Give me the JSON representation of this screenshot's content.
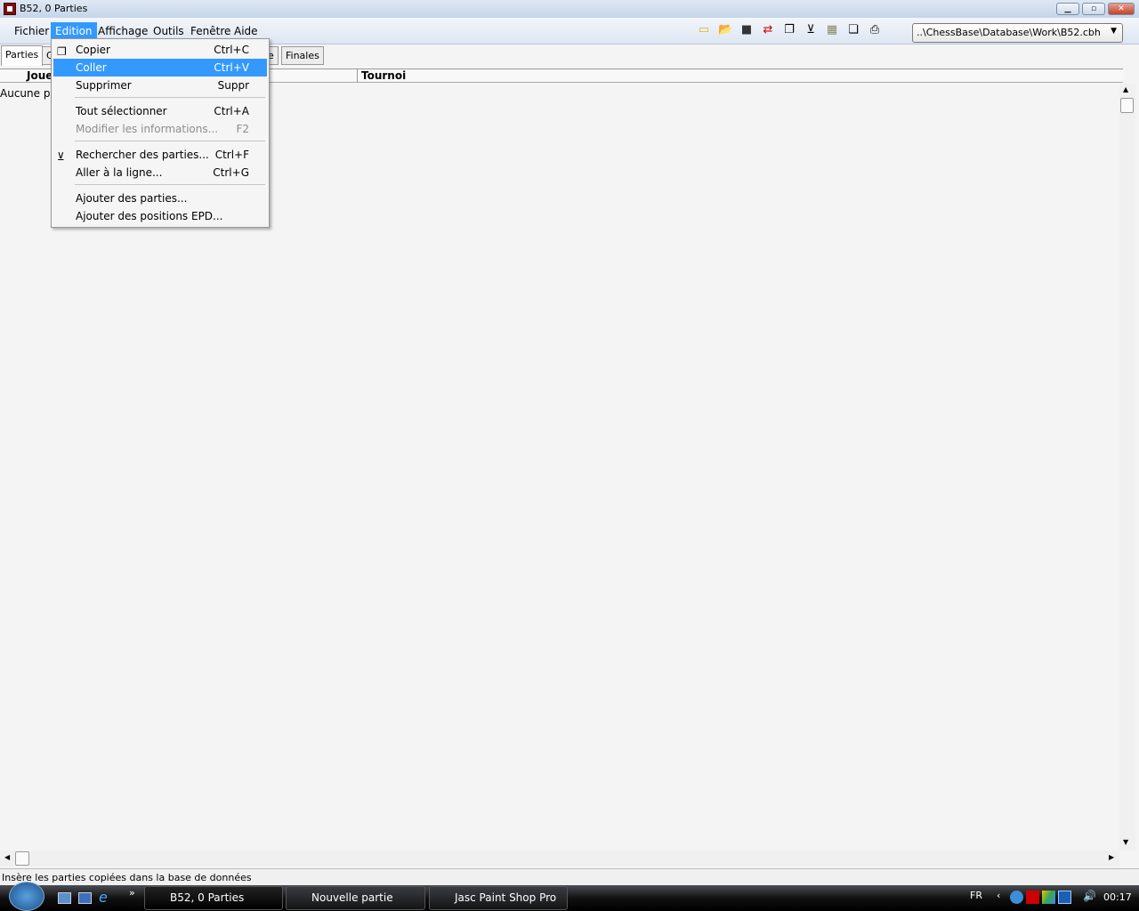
{
  "window": {
    "title": "B52,  0 Parties"
  },
  "menubar": {
    "items": [
      "Fichier",
      "Edition",
      "Affichage",
      "Outils",
      "Fenêtre",
      "Aide"
    ]
  },
  "toolbar": {
    "icons": [
      "new-database-icon",
      "open-icon",
      "save-icon",
      "exchange-icon",
      "copy-icon",
      "filter-icon",
      "board-icon",
      "clipboard-icon",
      "print-icon"
    ],
    "database_path": "..\\ChessBase\\Database\\Work\\B52.cbh"
  },
  "tabs": [
    "Parties",
    "C",
    "e",
    "Finales"
  ],
  "columns": [
    "Joue",
    "Tournoi"
  ],
  "list": {
    "empty_text": "Aucune pa"
  },
  "edit_menu": {
    "items": [
      {
        "label": "Copier",
        "shortcut": "Ctrl+C",
        "icon": "copy-icon"
      },
      {
        "label": "Coller",
        "shortcut": "Ctrl+V",
        "highlighted": true
      },
      {
        "label": "Supprimer",
        "shortcut": "Suppr"
      },
      {
        "label": "Tout sélectionner",
        "shortcut": "Ctrl+A"
      },
      {
        "label": "Modifier les informations...",
        "shortcut": "F2",
        "disabled": true
      },
      {
        "label": "Rechercher des parties...",
        "shortcut": "Ctrl+F",
        "icon": "search-filter-icon"
      },
      {
        "label": "Aller à la ligne...",
        "shortcut": "Ctrl+G"
      },
      {
        "label": "Ajouter des parties...",
        "shortcut": ""
      },
      {
        "label": "Ajouter des positions EPD...",
        "shortcut": ""
      }
    ]
  },
  "status": {
    "text": "Insère les parties copiées dans la base de données"
  },
  "taskbar": {
    "tasks": [
      "B52,  0 Parties",
      "Nouvelle partie",
      "Jasc Paint Shop Pro"
    ],
    "language": "FR",
    "clock": "00:17"
  },
  "colors": {
    "highlight": "#3399ff"
  }
}
